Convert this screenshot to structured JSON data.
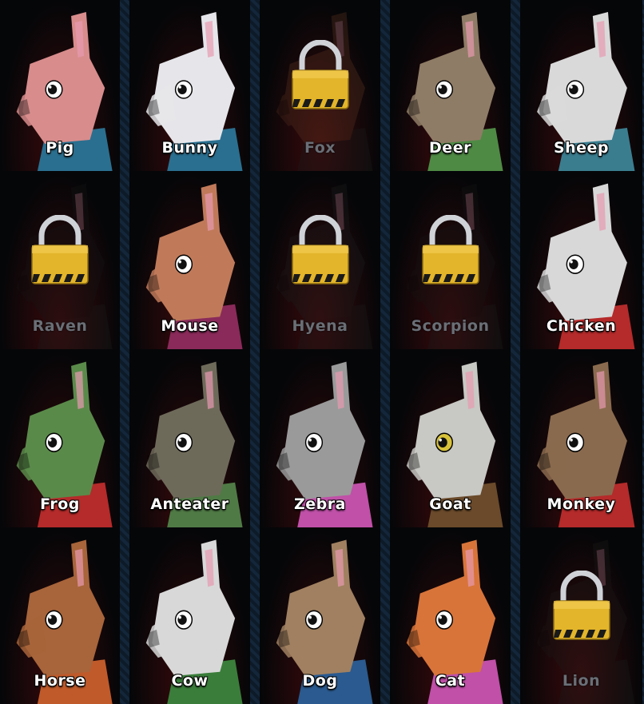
{
  "characters": [
    {
      "name": "Pig",
      "locked": false,
      "fur": "#d88c8c",
      "accent": "#2a6f8f",
      "eye": "plain"
    },
    {
      "name": "Bunny",
      "locked": false,
      "fur": "#e6e6ea",
      "accent": "#2a6f8f",
      "eye": "plain"
    },
    {
      "name": "Fox",
      "locked": true,
      "fur": "#5a3220",
      "accent": "#1b1b1b",
      "eye": "none"
    },
    {
      "name": "Deer",
      "locked": false,
      "fur": "#8f7c66",
      "accent": "#4f8a45",
      "eye": "plain"
    },
    {
      "name": "Sheep",
      "locked": false,
      "fur": "#d9d9d9",
      "accent": "#3a7d8f",
      "eye": "plain"
    },
    {
      "name": "Raven",
      "locked": true,
      "fur": "#151515",
      "accent": "#1b1b1b",
      "eye": "none"
    },
    {
      "name": "Mouse",
      "locked": false,
      "fur": "#c07a5a",
      "accent": "#8a2a5a",
      "eye": "plain"
    },
    {
      "name": "Hyena",
      "locked": true,
      "fur": "#1d1d1d",
      "accent": "#1b1b1b",
      "eye": "none"
    },
    {
      "name": "Scorpion",
      "locked": true,
      "fur": "#151515",
      "accent": "#1b1b1b",
      "eye": "none"
    },
    {
      "name": "Chicken",
      "locked": false,
      "fur": "#d8d8d8",
      "accent": "#b52a2a",
      "eye": "plain"
    },
    {
      "name": "Frog",
      "locked": false,
      "fur": "#5a8a4a",
      "accent": "#b52a2a",
      "eye": "plain"
    },
    {
      "name": "Anteater",
      "locked": false,
      "fur": "#6e6a5a",
      "accent": "#4f7a45",
      "eye": "plain"
    },
    {
      "name": "Zebra",
      "locked": false,
      "fur": "#9a9a9a",
      "accent": "#c050a8",
      "eye": "plain"
    },
    {
      "name": "Goat",
      "locked": false,
      "fur": "#c8c8c4",
      "accent": "#6a4a2a",
      "eye": "gold"
    },
    {
      "name": "Monkey",
      "locked": false,
      "fur": "#8a6a4e",
      "accent": "#b52a2a",
      "eye": "plain"
    },
    {
      "name": "Horse",
      "locked": false,
      "fur": "#a8643a",
      "accent": "#c05a2a",
      "eye": "plain"
    },
    {
      "name": "Cow",
      "locked": false,
      "fur": "#d8d8d8",
      "accent": "#3a7d3a",
      "eye": "plain"
    },
    {
      "name": "Dog",
      "locked": false,
      "fur": "#a08060",
      "accent": "#2a5a8f",
      "eye": "plain"
    },
    {
      "name": "Cat",
      "locked": false,
      "fur": "#d8743a",
      "accent": "#c050a8",
      "eye": "plain"
    },
    {
      "name": "Lion",
      "locked": true,
      "fur": "#1d1a18",
      "accent": "#1b1b1b",
      "eye": "none"
    }
  ],
  "colors": {
    "tile_bg_top": "#050608",
    "tile_bg_bottom": "#3a0a0c",
    "lock_body": "#e3b52a",
    "lock_shackle": "#cfd3d8"
  }
}
